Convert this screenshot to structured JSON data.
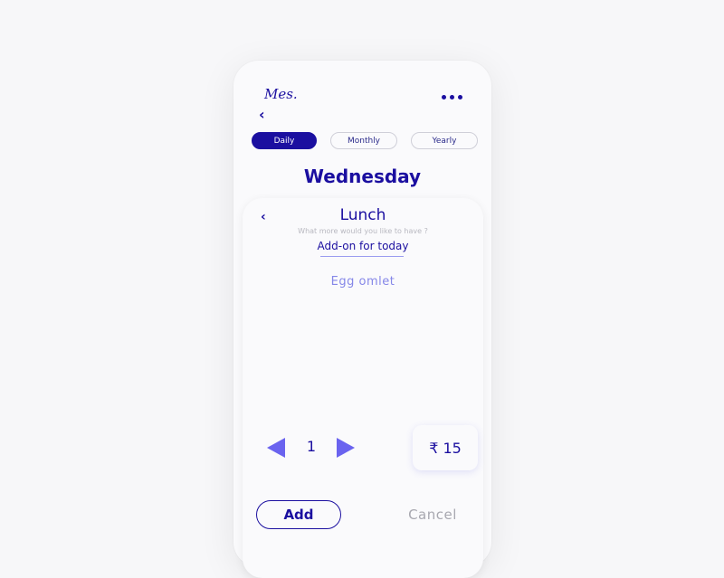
{
  "app": {
    "logo": "Mes."
  },
  "header": {
    "back_icon": "chevron-left-icon",
    "menu_icon": "more-dots-icon"
  },
  "tabs": [
    {
      "label": "Daily",
      "active": true
    },
    {
      "label": "Monthly",
      "active": false
    },
    {
      "label": "Yearly",
      "active": false
    }
  ],
  "day": "Wednesday",
  "card": {
    "title": "Lunch",
    "subtitle": "What more would you like to have ?",
    "heading": "Add-on for today",
    "item": "Egg omlet",
    "quantity": "1",
    "price": "₹ 15",
    "add_label": "Add",
    "cancel_label": "Cancel"
  },
  "colors": {
    "primary": "#1b0fa0",
    "accent": "#6a63ef",
    "muted": "#a8a8b0"
  }
}
